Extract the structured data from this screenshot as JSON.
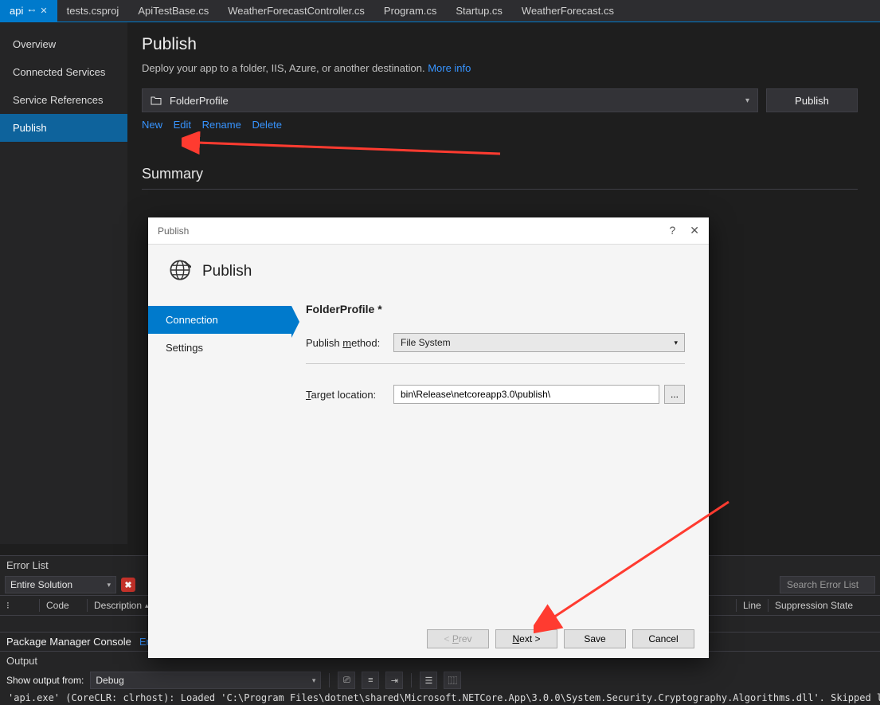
{
  "tabs": {
    "active": "api",
    "items": [
      "tests.csproj",
      "ApiTestBase.cs",
      "WeatherForecastController.cs",
      "Program.cs",
      "Startup.cs",
      "WeatherForecast.cs"
    ]
  },
  "sidenav": {
    "items": [
      "Overview",
      "Connected Services",
      "Service References",
      "Publish"
    ],
    "selected": "Publish"
  },
  "page": {
    "heading": "Publish",
    "subtitle": "Deploy your app to a folder, IIS, Azure, or another destination.",
    "more_info": "More info",
    "profile_selected": "FolderProfile",
    "publish_btn": "Publish",
    "links": {
      "new": "New",
      "edit": "Edit",
      "rename": "Rename",
      "delete": "Delete"
    },
    "summary_title": "Summary"
  },
  "dialog": {
    "title": "Publish",
    "header": "Publish",
    "steps": {
      "connection": "Connection",
      "settings": "Settings"
    },
    "form": {
      "profile_name": "FolderProfile *",
      "method_label_pre": "Publish ",
      "method_label_u": "m",
      "method_label_post": "ethod:",
      "method_value": "File System",
      "target_label_u": "T",
      "target_label_post": "arget location:",
      "target_value": "bin\\Release\\netcoreapp3.0\\publish\\",
      "browse": "..."
    },
    "buttons": {
      "prev": "< Prev",
      "next": "Next >",
      "save": "Save",
      "cancel": "Cancel"
    }
  },
  "errorlist": {
    "title": "Error List",
    "scope": "Entire Solution",
    "search_placeholder": "Search Error List",
    "cols": {
      "code": "Code",
      "desc": "Description",
      "line": "Line",
      "state": "Suppression State"
    }
  },
  "pmc": {
    "title": "Package Manager Console",
    "link": "Erro"
  },
  "output": {
    "title": "Output",
    "from_label": "Show output from:",
    "from_value": "Debug",
    "line": "'api.exe' (CoreCLR: clrhost): Loaded 'C:\\Program Files\\dotnet\\shared\\Microsoft.NETCore.App\\3.0.0\\System.Security.Cryptography.Algorithms.dll'. Skipped load"
  }
}
